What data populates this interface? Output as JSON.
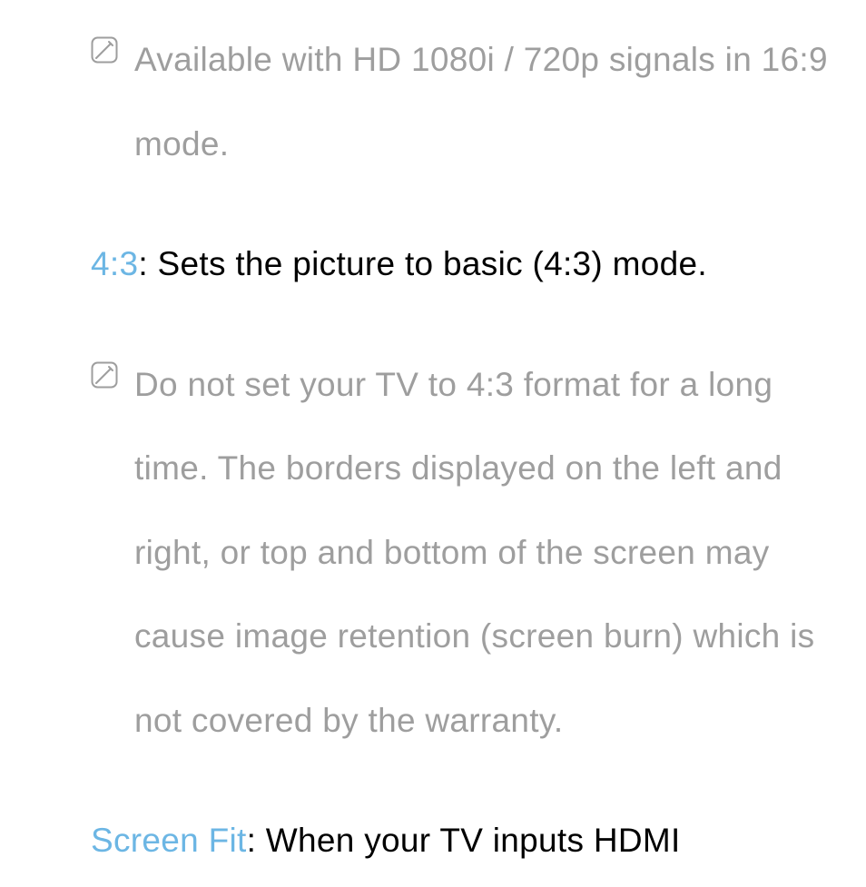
{
  "note1": {
    "text": "Available with HD 1080i / 720p signals in 16:9 mode."
  },
  "entry1": {
    "term": "4:3",
    "separator": ": ",
    "desc": "Sets the picture to basic (4:3) mode."
  },
  "note2": {
    "text": "Do not set your TV to 4:3 format for a long time. The borders displayed on the left and right, or top and bottom of the screen may cause image retention (screen burn) which is not covered by the warranty."
  },
  "entry2": {
    "term": "Screen Fit",
    "separator": ": ",
    "desc": "When your TV inputs HDMI"
  }
}
